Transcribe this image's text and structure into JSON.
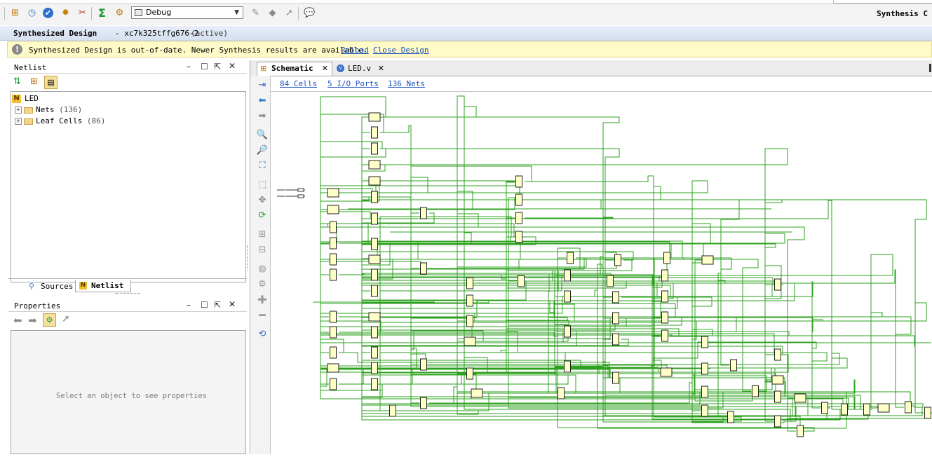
{
  "toolbar": {
    "config_value": "Debug",
    "flow_title": "Synthesis C"
  },
  "design": {
    "title": "Synthesized Design",
    "part": "- xc7k325tffg676-2",
    "state": "(active)"
  },
  "banner": {
    "message": "Synthesized Design is out-of-date. Newer Synthesis results are available.",
    "reload": "Reload",
    "close": "Close Design"
  },
  "netlist": {
    "title": "Netlist",
    "root": "LED",
    "items": [
      {
        "label": "Nets",
        "count": "(136)"
      },
      {
        "label": "Leaf Cells",
        "count": "(86)"
      }
    ]
  },
  "left_tabs": {
    "sources": "Sources",
    "netlist": "Netlist"
  },
  "properties": {
    "title": "Properties",
    "empty": "Select an object to see properties"
  },
  "editor_tabs": {
    "schematic": "Schematic",
    "file": "LED.v"
  },
  "schematic_info": {
    "cells": "84 Cells",
    "ports": "5 I/O Ports",
    "nets": "136 Nets"
  },
  "colors": {
    "wire": "#2ea01f",
    "cell_fill": "#ffffc8",
    "accent_link": "#1a4fbf",
    "banner_bg": "#fffbc8"
  }
}
